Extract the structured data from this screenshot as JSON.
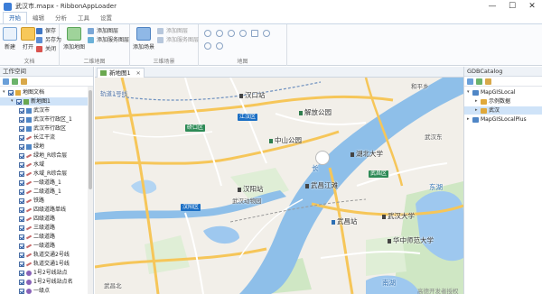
{
  "window": {
    "title": "武汉市.mapx - RibbonAppLoader",
    "controls": [
      "—",
      "☐",
      "✕"
    ]
  },
  "ribbon": {
    "tabs": [
      "开始",
      "编辑",
      "分析",
      "工具",
      "设置"
    ],
    "active_tab": 0,
    "groups": {
      "document": {
        "label": "文档",
        "new_label": "新建",
        "open_label": "打开",
        "save_label": "保存",
        "save_as_label": "另存为",
        "close_label": "关闭"
      },
      "map2d": {
        "label": "二维地图",
        "add_map_label": "添加地图",
        "add_layer_label": "添加图层",
        "add_service_layer_label": "添加服务图层"
      },
      "scene3d": {
        "label": "三维场景",
        "add_scene_label": "添加场景",
        "add_layer_label": "添加图层",
        "add_service_layer_label": "添加服务图层"
      },
      "view": {
        "label": "地图"
      }
    }
  },
  "workspace": {
    "title": "工作空间",
    "tree": [
      {
        "label": "地图文档",
        "level": 0,
        "kind": "doc"
      },
      {
        "label": "新地图1",
        "level": 1,
        "kind": "map",
        "selected": true
      },
      {
        "label": "武汉市",
        "level": 2,
        "kind": "poly"
      },
      {
        "label": "武汉市行政区_1",
        "level": 2,
        "kind": "poly"
      },
      {
        "label": "武汉市行政区",
        "level": 2,
        "kind": "poly"
      },
      {
        "label": "长江干流",
        "level": 2,
        "kind": "line"
      },
      {
        "label": "绿地",
        "level": 2,
        "kind": "poly"
      },
      {
        "label": "绿地_R综合层",
        "level": 2,
        "kind": "line"
      },
      {
        "label": "水域",
        "level": 2,
        "kind": "line"
      },
      {
        "label": "水域_R综合层",
        "level": 2,
        "kind": "line"
      },
      {
        "label": "一级道路_1",
        "level": 2,
        "kind": "line"
      },
      {
        "label": "二级道路_1",
        "level": 2,
        "kind": "line"
      },
      {
        "label": "铁路",
        "level": 2,
        "kind": "line"
      },
      {
        "label": "四级道路单线",
        "level": 2,
        "kind": "line"
      },
      {
        "label": "四级道路",
        "level": 2,
        "kind": "line"
      },
      {
        "label": "三级道路",
        "level": 2,
        "kind": "line"
      },
      {
        "label": "二级道路",
        "level": 2,
        "kind": "line"
      },
      {
        "label": "一级道路",
        "level": 2,
        "kind": "line"
      },
      {
        "label": "轨道交通2号线",
        "level": 2,
        "kind": "line"
      },
      {
        "label": "轨道交通1号线",
        "level": 2,
        "kind": "line"
      },
      {
        "label": "1号2号线站点",
        "level": 2,
        "kind": "point"
      },
      {
        "label": "1号2号线站点名",
        "level": 2,
        "kind": "point"
      },
      {
        "label": "一级点",
        "level": 2,
        "kind": "point"
      }
    ]
  },
  "map": {
    "tab_label": "新地图1",
    "labels": {
      "hankou": "汉口站",
      "jiefang_park": "解放公园",
      "zhongshan_park": "中山公园",
      "hubei_univ": "湖北大学",
      "hanyang": "汉阳站",
      "zoo": "武汉动物园",
      "wuchang_river": "武昌江滩",
      "wuchang_station": "武昌站",
      "wuhan_univ": "武汉大学",
      "huazhong_normal": "华中师范大学",
      "heping": "和平乡",
      "rail_line1": "轨道1号线",
      "donghu": "东湖",
      "nanhu": "南湖",
      "wuchang_north": "武昌北",
      "water_sm": "长",
      "wuhan_east": "武汉东"
    },
    "shields": {
      "hanyang_district": "硚口区",
      "jianghan": "江汉区",
      "hanyang2": "汉阳区",
      "wuchang_district": "武昌区"
    },
    "watermark": "高德开发者授权"
  },
  "catalog": {
    "title": "GDBCatalog",
    "tree": [
      {
        "label": "MapGISLocal",
        "level": 0,
        "expanded": true
      },
      {
        "label": "示例数据",
        "level": 1
      },
      {
        "label": "武汉",
        "level": 1,
        "selected": true
      },
      {
        "label": "MapGISLocalPlus",
        "level": 0
      }
    ]
  },
  "colors": {
    "accent": "#1f5fae",
    "selection": "#cfe3f8",
    "river": "#7fb0e3",
    "green": "#bfe3b4",
    "road_major": "#f6c659",
    "road_secondary": "#fdf0b9",
    "highway_shield": "#1c6fc4"
  },
  "icons": {
    "app": "app-icon",
    "new": "new-document-icon",
    "open": "open-folder-icon",
    "add_map": "add-map-icon",
    "add_scene": "add-scene-icon",
    "layers": "layers-icon",
    "zoom_in": "zoom-in-icon",
    "zoom_out": "zoom-out-icon"
  }
}
